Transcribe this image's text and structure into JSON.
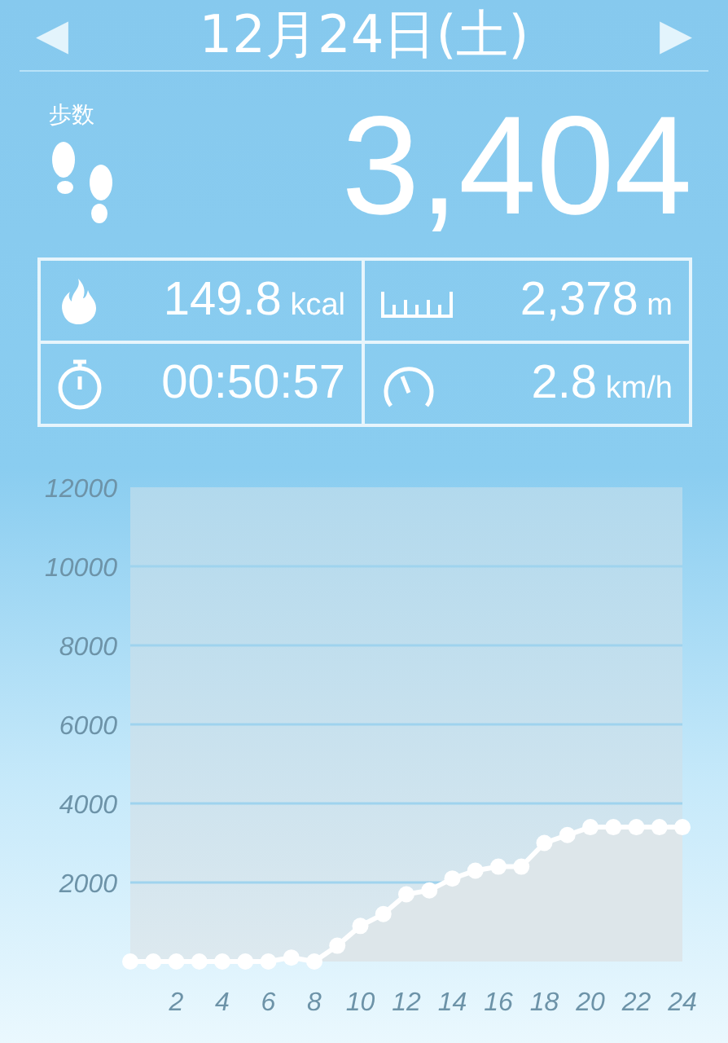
{
  "header": {
    "prev": "◀",
    "date": "12月24日(土)",
    "next": "▶"
  },
  "steps": {
    "label": "歩数",
    "value": "3,404"
  },
  "stats": [
    {
      "kind": "calories",
      "value": "149.8",
      "unit": "kcal"
    },
    {
      "kind": "distance",
      "value": "2,378",
      "unit": "m"
    },
    {
      "kind": "time",
      "value": "00:50:57"
    },
    {
      "kind": "speed",
      "value": "2.8",
      "unit": "km/h"
    }
  ],
  "chart": {
    "chart_data": {
      "type": "area",
      "x": [
        0,
        1,
        2,
        3,
        4,
        5,
        6,
        7,
        8,
        9,
        10,
        11,
        12,
        13,
        14,
        15,
        16,
        17,
        18,
        19,
        20,
        21,
        22,
        23,
        24
      ],
      "series": [
        {
          "color": "#ffffff",
          "values": [
            0,
            0,
            0,
            0,
            0,
            0,
            0,
            100,
            0,
            400,
            900,
            1200,
            1700,
            1800,
            2100,
            2300,
            2400,
            2400,
            3000,
            3200,
            3400,
            3400,
            3400,
            3400,
            3400
          ]
        }
      ],
      "grid": true,
      "xlim": [
        0,
        24
      ],
      "ylim": [
        0,
        12000
      ],
      "xticks": [
        2,
        4,
        6,
        8,
        10,
        12,
        14,
        16,
        18,
        20,
        22,
        24
      ],
      "yticks": [
        2000,
        4000,
        6000,
        8000,
        10000,
        12000
      ]
    }
  }
}
